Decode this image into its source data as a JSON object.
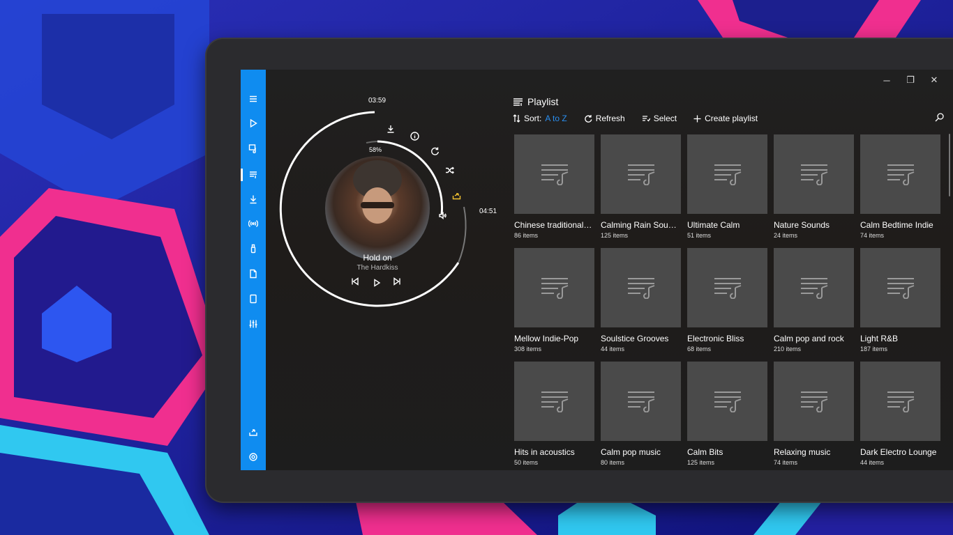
{
  "window": {
    "minimize_glyph": "─",
    "restore_glyph": "❐",
    "close_glyph": "✕"
  },
  "rail": {
    "accent": "#0f8cf0",
    "items": [
      {
        "icon": "hamburger-icon"
      },
      {
        "icon": "play-icon"
      },
      {
        "icon": "music-library-icon"
      },
      {
        "icon": "playlist-icon"
      },
      {
        "icon": "download-icon"
      },
      {
        "icon": "radio-icon"
      },
      {
        "icon": "usb-icon"
      },
      {
        "icon": "file-icon"
      },
      {
        "icon": "tablet-icon"
      },
      {
        "icon": "equalizer-icon"
      },
      {
        "icon": "share-icon"
      },
      {
        "icon": "settings-icon"
      }
    ]
  },
  "player": {
    "elapsed": "03:59",
    "duration": "04:51",
    "volume_percent": "58%",
    "volume_fraction": 0.58,
    "title": "Hold on",
    "artist": "The Hardkiss"
  },
  "playlist": {
    "heading": "Playlist",
    "sort_label": "Sort:",
    "sort_value": "A to Z",
    "refresh_label": "Refresh",
    "select_label": "Select",
    "create_label": "Create playlist",
    "items": [
      {
        "name": "Chinese traditional ...",
        "count": "86 items"
      },
      {
        "name": "Calming Rain Sound...",
        "count": "125 items"
      },
      {
        "name": "Ultimate Calm",
        "count": "51 items"
      },
      {
        "name": "Nature Sounds",
        "count": "24 items"
      },
      {
        "name": "Calm Bedtime Indie",
        "count": "74 items"
      },
      {
        "name": "Mellow Indie-Pop",
        "count": "308 items"
      },
      {
        "name": "Soulstice Grooves",
        "count": "44 items"
      },
      {
        "name": "Electronic Bliss",
        "count": "68 items"
      },
      {
        "name": "Calm pop and rock",
        "count": "210 items"
      },
      {
        "name": "Light R&B",
        "count": "187 items"
      },
      {
        "name": "Hits in acoustics",
        "count": "50 items"
      },
      {
        "name": "Calm pop music",
        "count": "80 items"
      },
      {
        "name": "Calm Bits",
        "count": "125 items"
      },
      {
        "name": "Relaxing music",
        "count": "74 items"
      },
      {
        "name": "Dark Electro Lounge",
        "count": "44 items"
      }
    ]
  }
}
